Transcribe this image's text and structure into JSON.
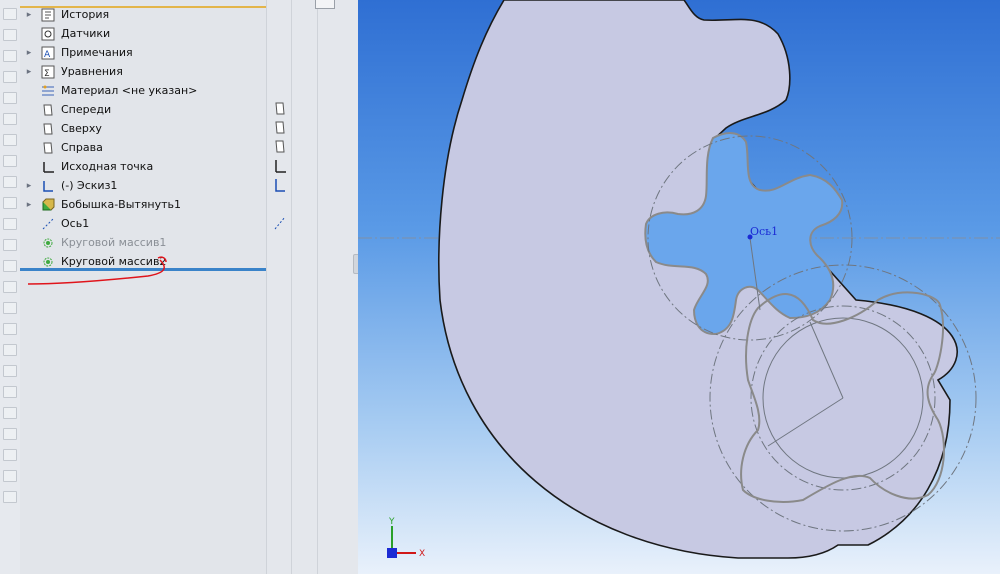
{
  "tree": {
    "items": [
      {
        "label": "История",
        "icon": "history-icon",
        "expandable": true,
        "dim": false
      },
      {
        "label": "Датчики",
        "icon": "sensor-icon",
        "expandable": false,
        "dim": false
      },
      {
        "label": "Примечания",
        "icon": "annotations-icon",
        "expandable": true,
        "dim": false
      },
      {
        "label": "Уравнения",
        "icon": "equations-icon",
        "expandable": true,
        "dim": false
      },
      {
        "label": "Материал <не указан>",
        "icon": "material-icon",
        "expandable": false,
        "dim": false
      },
      {
        "label": "Спереди",
        "icon": "plane-icon",
        "expandable": false,
        "dim": false
      },
      {
        "label": "Сверху",
        "icon": "plane-icon",
        "expandable": false,
        "dim": false
      },
      {
        "label": "Справа",
        "icon": "plane-icon",
        "expandable": false,
        "dim": false
      },
      {
        "label": "Исходная точка",
        "icon": "origin-icon",
        "expandable": false,
        "dim": false
      },
      {
        "label": "(-) Эскиз1",
        "icon": "sketch-icon",
        "expandable": true,
        "dim": false
      },
      {
        "label": "Бобышка-Вытянуть1",
        "icon": "extrude-icon",
        "expandable": true,
        "dim": false
      },
      {
        "label": "Ось1",
        "icon": "axis-icon",
        "expandable": false,
        "dim": false
      },
      {
        "label": "Круговой массив1",
        "icon": "circular-pattern-icon",
        "expandable": false,
        "dim": true
      },
      {
        "label": "Круговой массив2",
        "icon": "circular-pattern-icon",
        "expandable": false,
        "dim": false
      }
    ]
  },
  "viewport": {
    "axis_label": "Ось1",
    "triad_y": "Y",
    "triad_x": "X"
  },
  "colors": {
    "accent": "#3a83c9",
    "part_fill": "#c7c9e3",
    "annotation_red": "#e0141b"
  }
}
